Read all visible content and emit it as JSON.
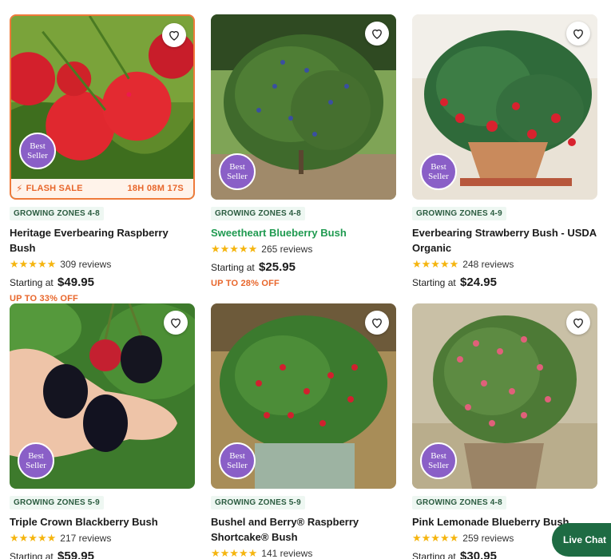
{
  "products": [
    {
      "zone": "GROWING ZONES 4-8",
      "title": "Heritage Everbearing Raspberry Bush",
      "stars": "★★★★★",
      "reviews": "309 reviews",
      "price_prefix": "Starting at",
      "price": "$49.95",
      "discount": "UP TO 33% OFF",
      "badge_line1": "Best",
      "badge_line2": "Seller",
      "flash_label": "FLASH SALE",
      "flash_timer": "18H 08M 17S"
    },
    {
      "zone": "GROWING ZONES 4-8",
      "title": "Sweetheart Blueberry Bush",
      "stars": "★★★★★",
      "reviews": "265 reviews",
      "price_prefix": "Starting at",
      "price": "$25.95",
      "discount": "UP TO 28% OFF",
      "badge_line1": "Best",
      "badge_line2": "Seller"
    },
    {
      "zone": "GROWING ZONES 4-9",
      "title": "Everbearing Strawberry Bush - USDA Organic",
      "stars": "★★★★★",
      "reviews": "248 reviews",
      "price_prefix": "Starting at",
      "price": "$24.95",
      "badge_line1": "Best",
      "badge_line2": "Seller"
    },
    {
      "zone": "GROWING ZONES 5-9",
      "title": "Triple Crown Blackberry Bush",
      "stars": "★★★★★",
      "reviews": "217 reviews",
      "price_prefix": "Starting at",
      "price": "$59.95",
      "badge_line1": "Best",
      "badge_line2": "Seller"
    },
    {
      "zone": "GROWING ZONES 5-9",
      "title": "Bushel and Berry® Raspberry Shortcake® Bush",
      "stars": "★★★★★",
      "reviews": "141 reviews",
      "badge_line1": "Best",
      "badge_line2": "Seller"
    },
    {
      "zone": "GROWING ZONES 4-8",
      "title": "Pink Lemonade Blueberry Bush",
      "stars": "★★★★★",
      "reviews": "259 reviews",
      "price_prefix": "Starting at",
      "price": "$30.95",
      "badge_line1": "Best",
      "badge_line2": "Seller"
    }
  ],
  "live_chat": "Live Chat",
  "icons": {
    "wishlist": "heart-outline-icon",
    "flash": "lightning-bolt-icon"
  },
  "colors": {
    "accent_orange": "#e8662b",
    "green_link": "#1f9a50",
    "badge_purple": "#8a5fc7",
    "chat_green": "#1e6b43"
  }
}
